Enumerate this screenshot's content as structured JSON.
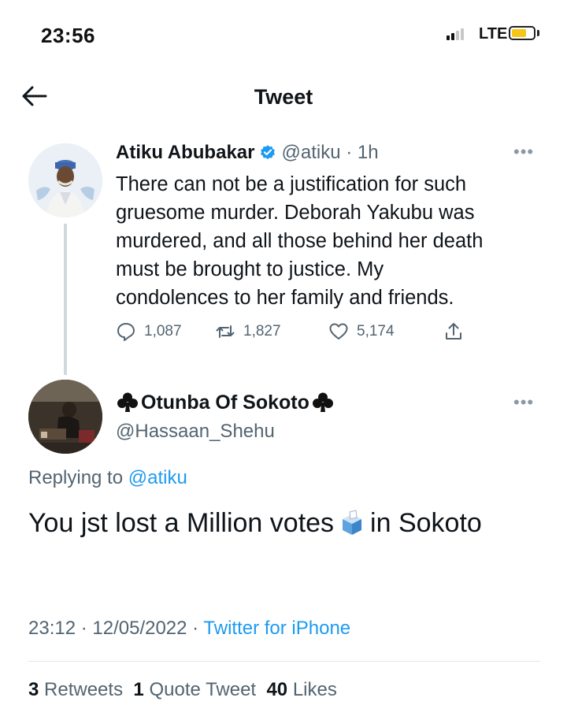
{
  "status_bar": {
    "time": "23:56",
    "network": "LTE",
    "battery_color": "#f5c518"
  },
  "header": {
    "back_icon": "arrow-left-icon",
    "title": "Tweet"
  },
  "parent_tweet": {
    "author_name": "Atiku Abubakar",
    "verified": true,
    "handle_time": "@atiku · 1h",
    "text": "There can not be a justification for such\ngruesome murder. Deborah Yakubu was\nmurdered, and all those behind her death\nmust be brought to justice. My\ncondolences to her family and friends.",
    "replies": "1,087",
    "retweets": "1,827",
    "likes": "5,174"
  },
  "reply_tweet": {
    "author_name": "Otunba Of Sokoto",
    "handle": "@Hassaan_Shehu",
    "replying_prefix": "Replying to ",
    "replying_to": "@atiku",
    "text_part1": "You jst lost a Million votes",
    "text_part2": "in Sokoto",
    "timestamp": "23:12 · 12/05/2022 · ",
    "source": "Twitter for iPhone",
    "retweets_count": "3",
    "retweets_label": "Retweets",
    "quotes_count": "1",
    "quotes_label": "Quote Tweet",
    "likes_count": "40",
    "likes_label": "Likes"
  },
  "colors": {
    "link_blue": "#1d9bf0",
    "secondary_text": "#536471",
    "primary_text": "#0f1419"
  }
}
